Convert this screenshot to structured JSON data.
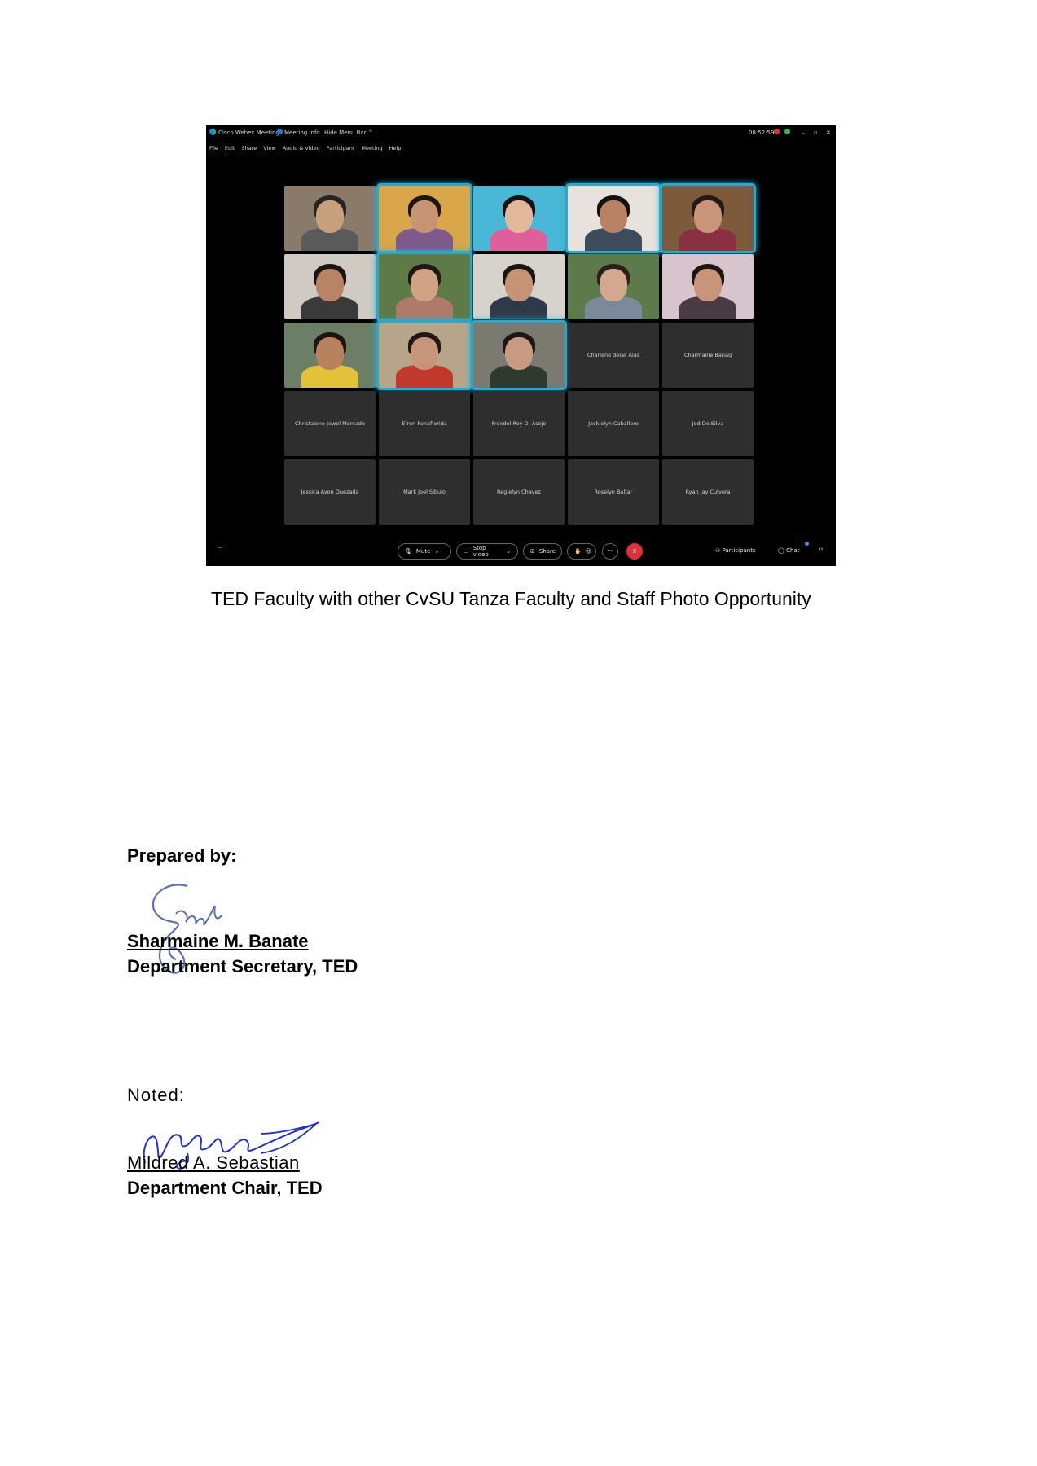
{
  "webex": {
    "app_name": "Cisco Webex Meetings",
    "meeting_info": "Meeting Info",
    "hide_menu_bar": "Hide Menu Bar",
    "time": "08:52:59",
    "menu": [
      "File",
      "Edit",
      "Share",
      "View",
      "Audio & Video",
      "Participant",
      "Meeting",
      "Help"
    ],
    "video_tiles": [
      {
        "active": false,
        "bg": "#8a7a6a",
        "face": "#c9a07e",
        "hair": "#2a2420",
        "shirt": "#5a5a5a"
      },
      {
        "active": true,
        "bg": "#d9a64a",
        "face": "#c79373",
        "hair": "#1d1714",
        "shirt": "#7d5a8a"
      },
      {
        "active": false,
        "bg": "#49b8d8",
        "face": "#e2b89a",
        "hair": "#1a1210",
        "shirt": "#e05f9a"
      },
      {
        "active": true,
        "bg": "#e8e2dc",
        "face": "#b88364",
        "hair": "#141010",
        "shirt": "#3e4b5c"
      },
      {
        "active": true,
        "bg": "#7d5a3c",
        "face": "#c99578",
        "hair": "#231a16",
        "shirt": "#8a3040"
      },
      {
        "active": false,
        "bg": "#cfcac2",
        "face": "#b98366",
        "hair": "#1a1412",
        "shirt": "#3a3a3a"
      },
      {
        "active": true,
        "bg": "#5e7a46",
        "face": "#d1a385",
        "hair": "#211814",
        "shirt": "#b07a6a"
      },
      {
        "active": false,
        "bg": "#d6d3cc",
        "face": "#c59474",
        "hair": "#1c1512",
        "shirt": "#2e3a4a"
      },
      {
        "active": false,
        "bg": "#5d7a4a",
        "face": "#d4a88c",
        "hair": "#2a201a",
        "shirt": "#7a8a9a"
      },
      {
        "active": false,
        "bg": "#d8c4cc",
        "face": "#c8957a",
        "hair": "#1e1614",
        "shirt": "#4a3a44"
      },
      {
        "active": false,
        "bg": "#6c7e66",
        "face": "#b9825f",
        "hair": "#1b1512",
        "shirt": "#e3c23a"
      },
      {
        "active": true,
        "bg": "#b7a58a",
        "face": "#c9957a",
        "hair": "#201814",
        "shirt": "#c0392b"
      },
      {
        "active": true,
        "bg": "#7a7a70",
        "face": "#c89a80",
        "hair": "#1d1612",
        "shirt": "#2e3a2e"
      }
    ],
    "name_tiles": [
      "Charlene delas Alas",
      "Charmaine Banag",
      "Christalene Jewel Mercado",
      "Efren Penaflorida",
      "Frendel Roy D. Asejo",
      "Jackielyn Caballero",
      "Jed De Silva",
      "Jessica Avon Quezada",
      "Mark Joel Sibulo",
      "Regielyn Chavez",
      "Roselyn Baltar",
      "Ryan Jay Culvera"
    ],
    "toolbar": {
      "mute": "Mute",
      "stop_video": "Stop video",
      "share": "Share",
      "more": "···",
      "end": "X",
      "participants": "Participants",
      "chat": "Chat"
    }
  },
  "caption": "TED Faculty with other CvSU Tanza Faculty and Staff Photo Opportunity",
  "prepared": {
    "label": "Prepared by:",
    "name": "Sharmaine M. Banate",
    "title": "Department Secretary, TED"
  },
  "noted": {
    "label": "Noted:",
    "name": "Mildred A. Sebastian",
    "title": "Department Chair, TED"
  },
  "colors": {
    "active_speaker_border": "#2aa7c9",
    "end_call": "#e0303a",
    "signature_1": "#5a6fb8",
    "signature_2": "#1f2fd0"
  }
}
